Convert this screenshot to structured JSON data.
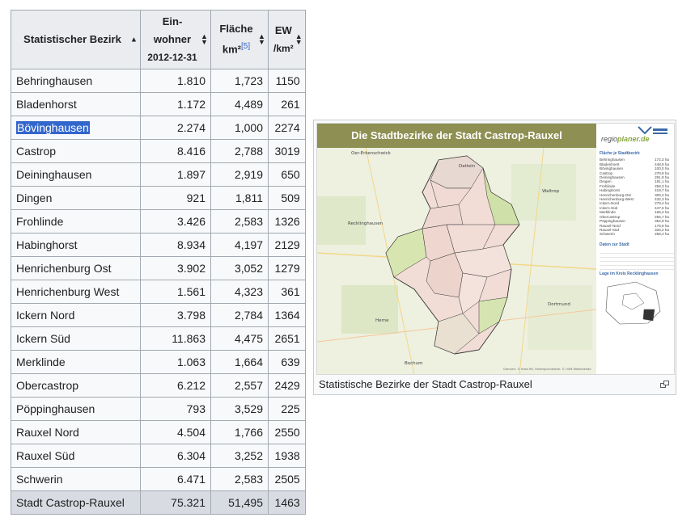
{
  "table": {
    "headers": {
      "name": "Statistischer Bezirk",
      "pop_line1": "Ein-",
      "pop_line2": "wohner",
      "pop_date": "2012-12-31",
      "area_line1": "Fläche",
      "area_unit": "km²",
      "area_ref": "[5]",
      "ew_line1": "EW",
      "ew_unit": "/km²"
    },
    "sort_icons": {
      "sorted_asc": "▲",
      "both_up": "▲",
      "both_down": "▼"
    },
    "rows": [
      {
        "name": "Behringhausen",
        "pop": "1.810",
        "area": "1,723",
        "density": "1150"
      },
      {
        "name": "Bladenhorst",
        "pop": "1.172",
        "area": "4,489",
        "density": "261"
      },
      {
        "name": "Bövinghausen",
        "pop": "2.274",
        "area": "1,000",
        "density": "2274"
      },
      {
        "name": "Castrop",
        "pop": "8.416",
        "area": "2,788",
        "density": "3019"
      },
      {
        "name": "Deininghausen",
        "pop": "1.897",
        "area": "2,919",
        "density": "650"
      },
      {
        "name": "Dingen",
        "pop": "921",
        "area": "1,811",
        "density": "509"
      },
      {
        "name": "Frohlinde",
        "pop": "3.426",
        "area": "2,583",
        "density": "1326"
      },
      {
        "name": "Habinghorst",
        "pop": "8.934",
        "area": "4,197",
        "density": "2129"
      },
      {
        "name": "Henrichenburg Ost",
        "pop": "3.902",
        "area": "3,052",
        "density": "1279"
      },
      {
        "name": "Henrichenburg West",
        "pop": "1.561",
        "area": "4,323",
        "density": "361"
      },
      {
        "name": "Ickern Nord",
        "pop": "3.798",
        "area": "2,784",
        "density": "1364"
      },
      {
        "name": "Ickern Süd",
        "pop": "11.863",
        "area": "4,475",
        "density": "2651"
      },
      {
        "name": "Merklinde",
        "pop": "1.063",
        "area": "1,664",
        "density": "639"
      },
      {
        "name": "Obercastrop",
        "pop": "6.212",
        "area": "2,557",
        "density": "2429"
      },
      {
        "name": "Pöppinghausen",
        "pop": "793",
        "area": "3,529",
        "density": "225"
      },
      {
        "name": "Rauxel Nord",
        "pop": "4.504",
        "area": "1,766",
        "density": "2550"
      },
      {
        "name": "Rauxel Süd",
        "pop": "6.304",
        "area": "3,252",
        "density": "1938"
      },
      {
        "name": "Schwerin",
        "pop": "6.471",
        "area": "2,583",
        "density": "2505"
      }
    ],
    "total": {
      "name": "Stadt Castrop-Rauxel",
      "pop": "75.321",
      "area": "51,495",
      "density": "1463"
    }
  },
  "figure": {
    "banner_title": "Die Stadtbezirke der Stadt Castrop-Rauxel",
    "logo_text_a": "regio",
    "logo_text_b": "planer.de",
    "legend_title": "Fläche je Stadtbezirk",
    "legend_rows": [
      {
        "name": "Behringhausen",
        "val": "172,3 ha"
      },
      {
        "name": "Bladenhorst",
        "val": "448,9 ha"
      },
      {
        "name": "Bövinghausen",
        "val": "100,0 ha"
      },
      {
        "name": "Castrop",
        "val": "278,8 ha"
      },
      {
        "name": "Deininghausen",
        "val": "291,9 ha"
      },
      {
        "name": "Dingen",
        "val": "181,1 ha"
      },
      {
        "name": "Frohlinde",
        "val": "258,3 ha"
      },
      {
        "name": "Habinghorst",
        "val": "419,7 ha"
      },
      {
        "name": "Henrichenburg-Ost",
        "val": "305,2 ha"
      },
      {
        "name": "Henrichenburg-West",
        "val": "432,3 ha"
      },
      {
        "name": "Ickern-Nord",
        "val": "278,4 ha"
      },
      {
        "name": "Ickern-Süd",
        "val": "447,5 ha"
      },
      {
        "name": "Merklinde",
        "val": "166,4 ha"
      },
      {
        "name": "Obercastrop",
        "val": "255,7 ha"
      },
      {
        "name": "Pöppinghausen",
        "val": "352,9 ha"
      },
      {
        "name": "Rauxel-Nord",
        "val": "176,6 ha"
      },
      {
        "name": "Rauxel-Süd",
        "val": "325,2 ha"
      },
      {
        "name": "Schwerin",
        "val": "258,3 ha"
      }
    ],
    "legend_data_title": "Daten zur Stadt",
    "legend_location_title": "Lage im Kreis Recklinghausen",
    "map_places": {
      "oer": "Oer-Erkenschwick",
      "datteln": "Datteln",
      "waltrop": "Waltrop",
      "recklinghausen": "Recklinghausen",
      "herne": "Herne",
      "dortmund": "Dortmund",
      "bochum": "Bochum"
    },
    "credit": "Grenzen: © Kreis RE, Hintergrundkarte: © OSM-Mitwirkende",
    "caption": "Statistische Bezirke der Stadt Castrop-Rauxel"
  },
  "colors": {
    "header_bg": "#eaecf0",
    "border": "#a2a9b1",
    "total_row_bg": "#d8dce2",
    "selection": "#3366cc",
    "banner": "#8e8f52",
    "legend_blue": "#3b6aa8"
  }
}
